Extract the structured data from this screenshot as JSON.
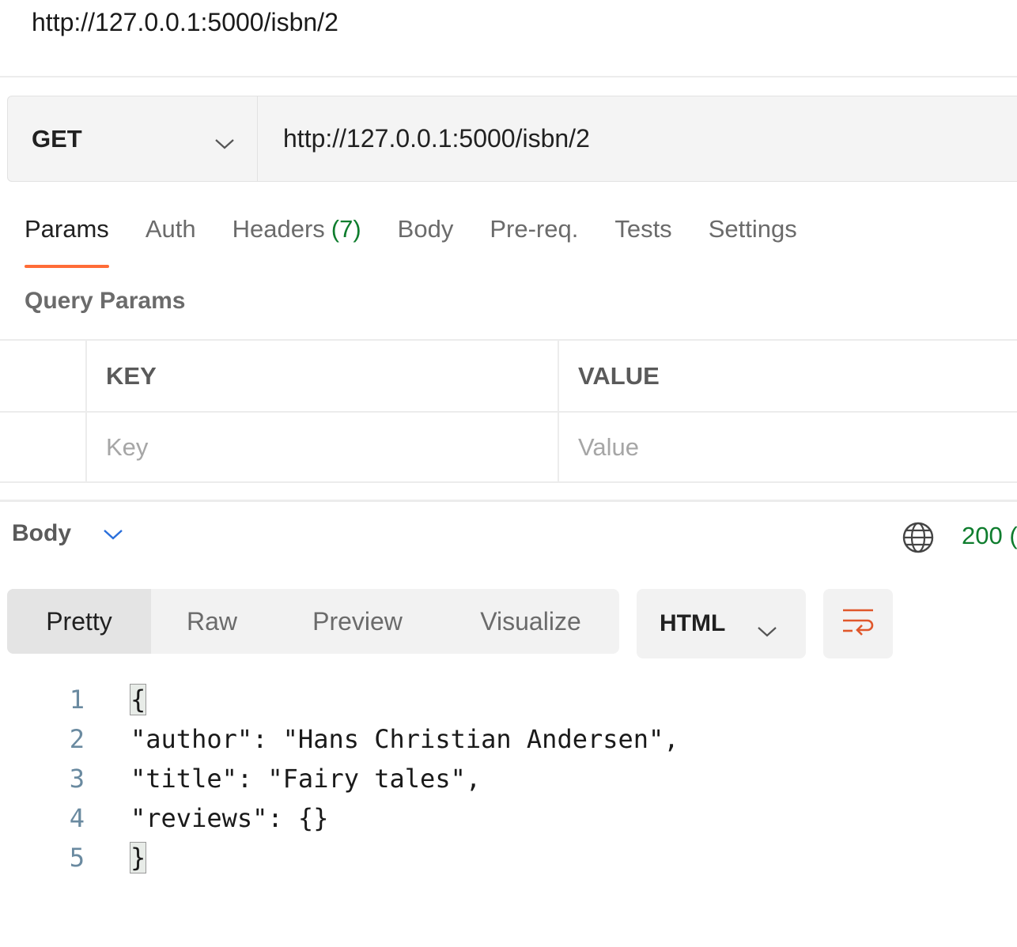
{
  "request": {
    "name": "http://127.0.0.1:5000/isbn/2",
    "method": "GET",
    "url": "http://127.0.0.1:5000/isbn/2"
  },
  "tabs": {
    "params": "Params",
    "auth": "Auth",
    "headers": "Headers",
    "headers_count": "(7)",
    "body": "Body",
    "prereq": "Pre-req.",
    "tests": "Tests",
    "settings": "Settings"
  },
  "query_params": {
    "title": "Query Params",
    "key_header": "KEY",
    "value_header": "VALUE",
    "key_placeholder": "Key",
    "value_placeholder": "Value"
  },
  "response": {
    "title": "Body",
    "status": "200 ("
  },
  "view_tabs": {
    "pretty": "Pretty",
    "raw": "Raw",
    "preview": "Preview",
    "visualize": "Visualize",
    "format": "HTML"
  },
  "code_lines": [
    {
      "num": "1",
      "open": "{",
      "text": "",
      "close": ""
    },
    {
      "num": "2",
      "open": "",
      "text": "\"author\": \"Hans Christian Andersen\",",
      "close": ""
    },
    {
      "num": "3",
      "open": "",
      "text": "\"title\": \"Fairy tales\",",
      "close": ""
    },
    {
      "num": "4",
      "open": "",
      "text": "\"reviews\": {}",
      "close": ""
    },
    {
      "num": "5",
      "open": "",
      "text": "",
      "close": "}"
    }
  ],
  "colors": {
    "accent": "#ff6c37",
    "status_green": "#0f7d2e",
    "wrap_icon": "#e0572b"
  },
  "icons": {
    "method_dropdown": "chevron-down-icon",
    "response_dropdown": "chevron-down-icon",
    "network": "globe-icon",
    "wrap": "wrap-lines-icon"
  }
}
